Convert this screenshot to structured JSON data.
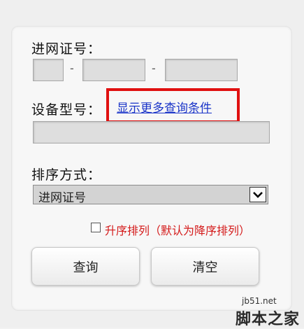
{
  "form": {
    "license_label": "进网证号：",
    "segment_separator": "-",
    "model_label": "设备型号：",
    "more_conditions_link": "显示更多查询条件",
    "sort_label": "排序方式：",
    "sort_select": {
      "selected": "进网证号",
      "options": [
        "进网证号"
      ]
    },
    "ascending_checkbox": {
      "checked": false,
      "label": "升序排列（默认为降序排列）"
    },
    "query_button": "查询",
    "clear_button": "清空"
  },
  "watermark": {
    "url": "jb51.net",
    "brand": "脚本之家"
  },
  "colors": {
    "highlight": "#e01010",
    "link": "#1a34c8",
    "hint_text": "#d41a1a"
  },
  "icons": {
    "select_arrow": "chevron-down-icon"
  }
}
